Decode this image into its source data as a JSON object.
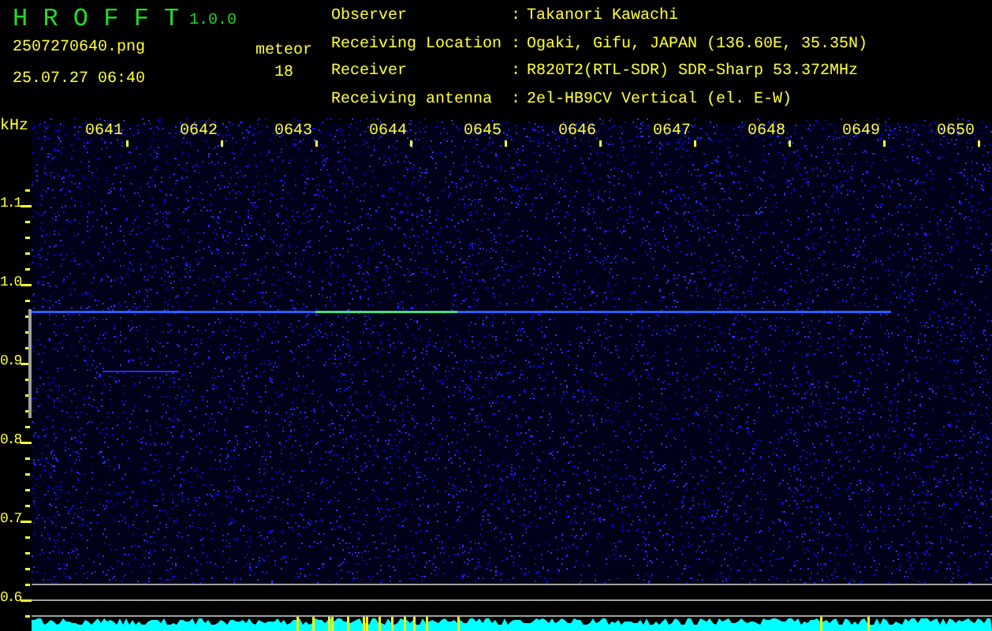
{
  "app": {
    "name": "H R O F F T",
    "version": "1.0.0"
  },
  "file": {
    "name": "2507270640.png",
    "datetime": "25.07.27 06:40"
  },
  "counter": {
    "label": "meteor",
    "value": "18"
  },
  "station": [
    {
      "label": "Observer",
      "separator": ":",
      "value": "Takanori Kawachi"
    },
    {
      "label": "Receiving Location",
      "separator": ":",
      "value": "Ogaki, Gifu, JAPAN (136.60E, 35.35N)"
    },
    {
      "label": "Receiver",
      "separator": ":",
      "value": "R820T2(RTL-SDR) SDR-Sharp 53.372MHz"
    },
    {
      "label": "Receiving antenna",
      "separator": ":",
      "value": "2el-HB9CV Vertical (el. E-W)"
    }
  ],
  "spectrogram": {
    "frequency_unit": "kHz",
    "time_labels": [
      "0641",
      "0642",
      "0643",
      "0644",
      "0645",
      "0646",
      "0647",
      "0648",
      "0649",
      "0650"
    ],
    "frequency_labels": [
      "1.1",
      "1.0",
      "0.9",
      "0.8",
      "0.7",
      "0.6"
    ]
  }
}
